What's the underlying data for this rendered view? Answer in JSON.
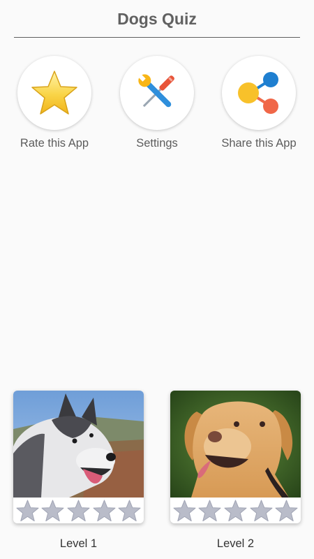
{
  "app": {
    "title": "Dogs Quiz"
  },
  "actions": [
    {
      "label": "Rate this App",
      "icon": "star-icon"
    },
    {
      "label": "Settings",
      "icon": "tools-icon"
    },
    {
      "label": "Share this App",
      "icon": "share-icon"
    }
  ],
  "levels": [
    {
      "label": "Level 1",
      "image": "husky-photo",
      "stars_filled": 0,
      "stars_total": 5
    },
    {
      "label": "Level 2",
      "image": "labrador-photo",
      "stars_filled": 0,
      "stars_total": 5
    }
  ],
  "colors": {
    "accent_star": "#f9c623",
    "empty_star": "#b9bcc9",
    "title": "#616161"
  }
}
